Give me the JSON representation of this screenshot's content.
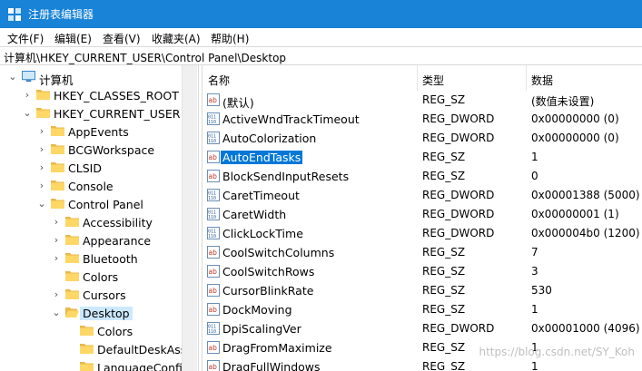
{
  "window": {
    "title": "注册表编辑器",
    "accent": "#1883d7"
  },
  "menu": [
    "文件(F)",
    "编辑(E)",
    "查看(V)",
    "收藏夹(A)",
    "帮助(H)"
  ],
  "address": "计算机\\HKEY_CURRENT_USER\\Control Panel\\Desktop",
  "tree": [
    {
      "label": "计算机",
      "depth": 0,
      "icon": "computer-icon",
      "expanded": true
    },
    {
      "label": "HKEY_CLASSES_ROOT",
      "depth": 1,
      "icon": "folder-icon",
      "expanded": false
    },
    {
      "label": "HKEY_CURRENT_USER",
      "depth": 1,
      "icon": "folder-icon",
      "expanded": true
    },
    {
      "label": "AppEvents",
      "depth": 2,
      "icon": "folder-icon",
      "expanded": false
    },
    {
      "label": "BCGWorkspace",
      "depth": 2,
      "icon": "folder-icon",
      "expanded": false
    },
    {
      "label": "CLSID",
      "depth": 2,
      "icon": "folder-icon",
      "expanded": false
    },
    {
      "label": "Console",
      "depth": 2,
      "icon": "folder-icon",
      "expanded": false
    },
    {
      "label": "Control Panel",
      "depth": 2,
      "icon": "folder-icon",
      "expanded": true
    },
    {
      "label": "Accessibility",
      "depth": 3,
      "icon": "folder-icon",
      "expanded": false
    },
    {
      "label": "Appearance",
      "depth": 3,
      "icon": "folder-icon",
      "expanded": false
    },
    {
      "label": "Bluetooth",
      "depth": 3,
      "icon": "folder-icon",
      "expanded": false
    },
    {
      "label": "Colors",
      "depth": 3,
      "icon": "folder-icon",
      "expanded": false,
      "leaf": true
    },
    {
      "label": "Cursors",
      "depth": 3,
      "icon": "folder-icon",
      "expanded": false
    },
    {
      "label": "Desktop",
      "depth": 3,
      "icon": "folder-open-icon",
      "expanded": true,
      "selected": true
    },
    {
      "label": "Colors",
      "depth": 4,
      "icon": "folder-icon",
      "leaf": true
    },
    {
      "label": "DefaultDeskAss",
      "depth": 4,
      "icon": "folder-icon",
      "leaf": true
    },
    {
      "label": "LanguageConfig",
      "depth": 4,
      "icon": "folder-icon",
      "leaf": true
    }
  ],
  "columns": {
    "name": "名称",
    "type": "类型",
    "data": "数据"
  },
  "values": [
    {
      "name": "(默认)",
      "type": "REG_SZ",
      "data": "(数值未设置)",
      "icon": "string-value-icon"
    },
    {
      "name": "ActiveWndTrackTimeout",
      "type": "REG_DWORD",
      "data": "0x00000000 (0)",
      "icon": "binary-value-icon"
    },
    {
      "name": "AutoColorization",
      "type": "REG_DWORD",
      "data": "0x00000000 (0)",
      "icon": "binary-value-icon"
    },
    {
      "name": "AutoEndTasks",
      "type": "REG_SZ",
      "data": "1",
      "icon": "string-value-icon",
      "selected": true
    },
    {
      "name": "BlockSendInputResets",
      "type": "REG_SZ",
      "data": "0",
      "icon": "string-value-icon"
    },
    {
      "name": "CaretTimeout",
      "type": "REG_DWORD",
      "data": "0x00001388 (5000)",
      "icon": "binary-value-icon"
    },
    {
      "name": "CaretWidth",
      "type": "REG_DWORD",
      "data": "0x00000001 (1)",
      "icon": "binary-value-icon"
    },
    {
      "name": "ClickLockTime",
      "type": "REG_DWORD",
      "data": "0x000004b0 (1200)",
      "icon": "binary-value-icon"
    },
    {
      "name": "CoolSwitchColumns",
      "type": "REG_SZ",
      "data": "7",
      "icon": "string-value-icon"
    },
    {
      "name": "CoolSwitchRows",
      "type": "REG_SZ",
      "data": "3",
      "icon": "string-value-icon"
    },
    {
      "name": "CursorBlinkRate",
      "type": "REG_SZ",
      "data": "530",
      "icon": "string-value-icon"
    },
    {
      "name": "DockMoving",
      "type": "REG_SZ",
      "data": "1",
      "icon": "string-value-icon"
    },
    {
      "name": "DpiScalingVer",
      "type": "REG_DWORD",
      "data": "0x00001000 (4096)",
      "icon": "binary-value-icon"
    },
    {
      "name": "DragFromMaximize",
      "type": "REG_SZ",
      "data": "1",
      "icon": "string-value-icon"
    },
    {
      "name": "DragFullWindows",
      "type": "REG_SZ",
      "data": "1",
      "icon": "string-value-icon"
    }
  ],
  "watermark": "https://blog.csdn.net/SY_Koh"
}
